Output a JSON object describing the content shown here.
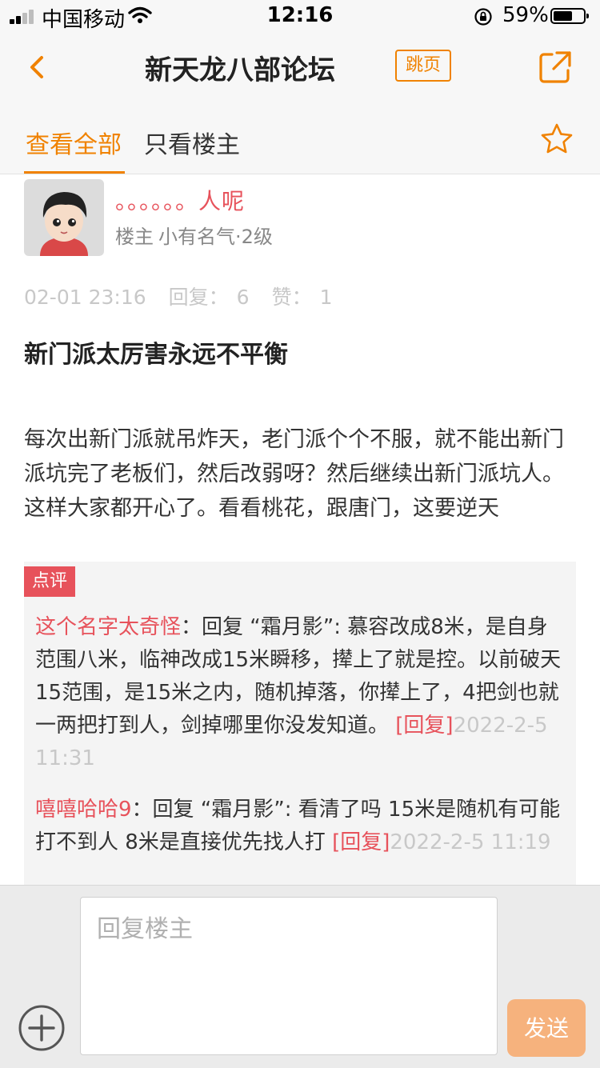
{
  "status_bar": {
    "carrier": "中国移动",
    "time": "12:16",
    "battery_percent": "59%",
    "battery_level": 0.59,
    "signal_bars": 2
  },
  "nav": {
    "title": "新天龙八部论坛",
    "jump_label": "跳页",
    "accent_color": "#f08200"
  },
  "tabs": {
    "all": "查看全部",
    "owner_only": "只看楼主",
    "active": "all"
  },
  "post": {
    "author": {
      "name": "。。。。。。人呢",
      "role": "楼主",
      "rank": "小有名气·2级"
    },
    "date": "02-01 23:16",
    "reply_label": "回复：",
    "reply_count": "6",
    "like_label": "赞：",
    "like_count": "1",
    "title": "新门派太厉害永远不平衡",
    "body": "每次出新门派就吊炸天，老门派个个不服，就不能出新门派坑完了老板们，然后改弱呀？然后继续出新门派坑人。这样大家都开心了。看看桃花，跟唐门，这要逆天"
  },
  "comments": {
    "tag": "点评",
    "items": [
      {
        "name": "这个名字太奇怪",
        "text": "：回复 “霜月影”: 慕容改成8米，是自身范围八米，临神改成15米瞬移，撵上了就是控。以前破天15范围，是15米之内，随机掉落，你撵上了，4把剑也就一两把打到人，剑掉哪里你没发知道。",
        "reply": "[回复]",
        "time": "2022-2-5 11:31"
      },
      {
        "name": "嘻嘻哈哈9",
        "text": "：回复 “霜月影”: 看清了吗 15米是随机有可能打不到人 8米是直接优先找人打 ",
        "reply": "[回复]",
        "time": "2022-2-5 11:19"
      }
    ]
  },
  "reply_bar": {
    "placeholder": "回复楼主",
    "send_label": "发送"
  }
}
